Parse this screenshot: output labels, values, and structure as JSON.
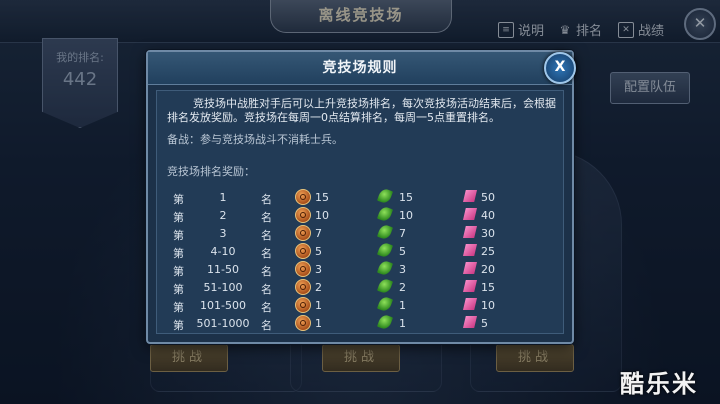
{
  "screen": {
    "title": "离线竞技场",
    "menu": [
      {
        "icon": "document-icon",
        "label": "说明"
      },
      {
        "icon": "trophy-icon",
        "label": "排名"
      },
      {
        "icon": "crossed-swords-icon",
        "label": "战绩"
      }
    ],
    "close_glyph": "✕",
    "my_rank_label": "我的排名:",
    "my_rank_value": "442",
    "team_button": "配置队伍",
    "challenge_button": "挑战",
    "watermark": "酷乐米"
  },
  "modal": {
    "title": "竞技场规则",
    "close_glyph": "X",
    "description": "竞技场中战胜对手后可以上升竞技场排名，每次竞技场活动结束后，会根据排名发放奖励。竞技场在每周一0点结算排名，每周一5点重置排名。",
    "note": "备战：参与竞技场战斗不消耗士兵。",
    "reward_title": "竞技场排名奖励：",
    "row_prefix": "第",
    "row_suffix": "名",
    "reward_icons": [
      "coin-icon",
      "green-leaf-icon",
      "pink-crystal-icon"
    ],
    "rows": [
      {
        "rank": "1",
        "r1": "15",
        "r2": "15",
        "r3": "50"
      },
      {
        "rank": "2",
        "r1": "10",
        "r2": "10",
        "r3": "40"
      },
      {
        "rank": "3",
        "r1": "7",
        "r2": "7",
        "r3": "30"
      },
      {
        "rank": "4-10",
        "r1": "5",
        "r2": "5",
        "r3": "25"
      },
      {
        "rank": "11-50",
        "r1": "3",
        "r2": "3",
        "r3": "20"
      },
      {
        "rank": "51-100",
        "r1": "2",
        "r2": "2",
        "r3": "15"
      },
      {
        "rank": "101-500",
        "r1": "1",
        "r2": "1",
        "r3": "10"
      },
      {
        "rank": "501-1000",
        "r1": "1",
        "r2": "1",
        "r3": "5"
      }
    ]
  }
}
